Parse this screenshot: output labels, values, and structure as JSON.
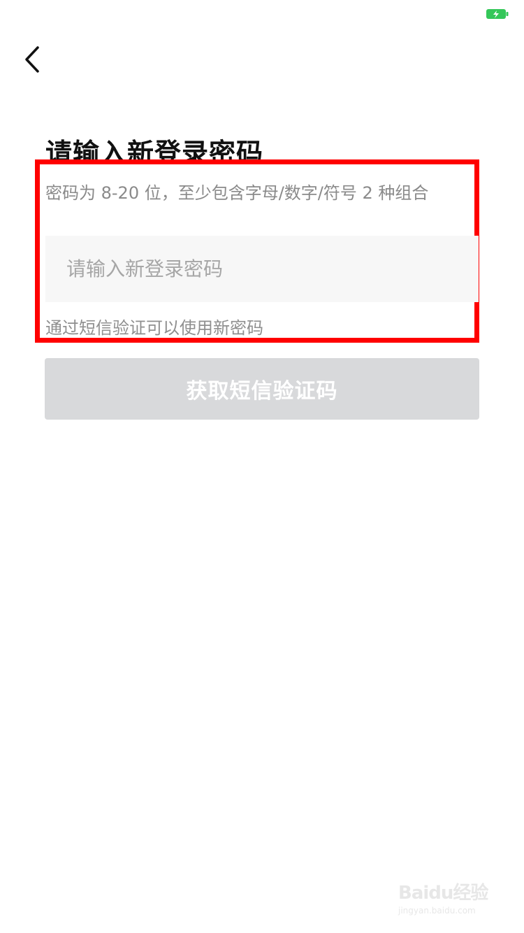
{
  "status_bar": {
    "battery_icon": "battery-charging-icon",
    "battery_color": "#34c759"
  },
  "nav": {
    "back_icon": "chevron-left-icon"
  },
  "page": {
    "title": "请输入新登录密码",
    "password_hint": "密码为 8-20 位，至少包含字母/数字/符号 2 种组合",
    "password_placeholder": "请输入新登录密码",
    "password_value": "",
    "sms_hint": "通过短信验证可以使用新密码",
    "sms_button_label": "获取短信验证码",
    "highlight_color": "#ff0000"
  },
  "watermark": {
    "logo_text": "Baidu经验",
    "url_text": "jingyan.baidu.com"
  }
}
